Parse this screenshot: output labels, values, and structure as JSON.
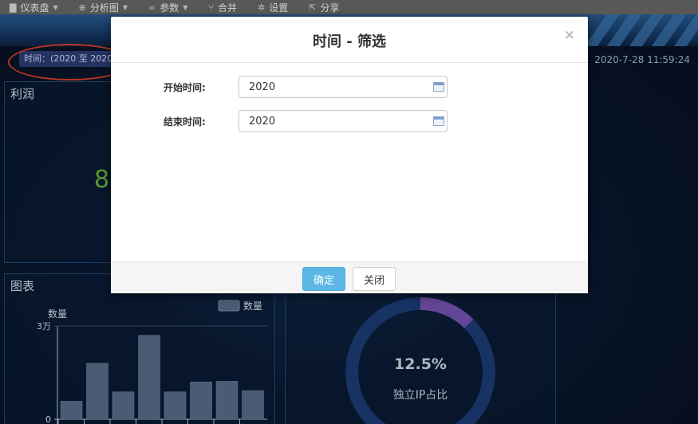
{
  "menu": {
    "items": [
      {
        "label": "仪表盘",
        "icon": "file-icon",
        "dropdown": true
      },
      {
        "label": "分析图",
        "icon": "plus-circle-icon",
        "dropdown": true
      },
      {
        "label": "参数",
        "icon": "binoculars-icon",
        "dropdown": true
      },
      {
        "label": "合并",
        "icon": "merge-icon",
        "dropdown": false
      },
      {
        "label": "设置",
        "icon": "gear-icon",
        "dropdown": false
      },
      {
        "label": "分享",
        "icon": "share-icon",
        "dropdown": false
      }
    ]
  },
  "dashboard": {
    "filter_tag": "时间：(2020 至 2020",
    "datetime": "2020-7-28 11:59:24",
    "profit_panel": {
      "title": "利润",
      "value_partial": "8"
    },
    "chart_panel": {
      "title": "图表"
    },
    "donut": {
      "percent": "12.5%",
      "label": "独立IP占比",
      "fraction": 0.125
    }
  },
  "chart_data": {
    "type": "bar",
    "ylabel": "数量",
    "legend": "数量",
    "ytick_labels": [
      "3万",
      "0"
    ],
    "ylim": [
      0,
      30000
    ],
    "values": [
      5800,
      18000,
      8800,
      27000,
      8800,
      12000,
      12200,
      9200
    ],
    "color": "#5a6f8f"
  },
  "modal": {
    "title": "时间 - 筛选",
    "close_glyph": "×",
    "fields": [
      {
        "label": "开始时间:",
        "value": "2020"
      },
      {
        "label": "结束时间:",
        "value": "2020"
      }
    ],
    "ok_label": "确定",
    "close_label": "关闭"
  },
  "colors": {
    "accent": "#5bb8e4",
    "profit_green": "#6cbf3c",
    "bar_fill": "#5a6f8f",
    "donut_track": "#1b3f7a",
    "donut_value": "#7b56b8",
    "annotation_red": "#e0432c"
  }
}
